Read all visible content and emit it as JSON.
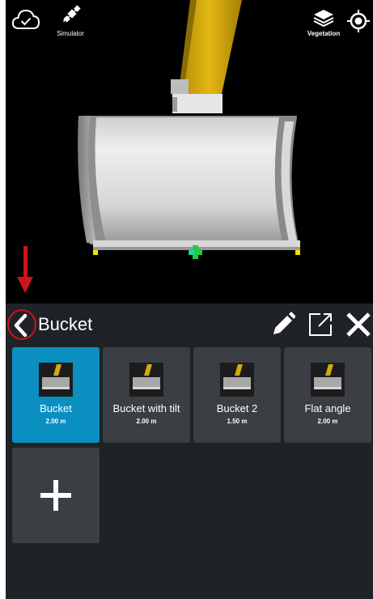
{
  "toolbar": {
    "simulator_label": "Simulator",
    "vegetation_label": "Vegetation"
  },
  "panel": {
    "title": "Bucket",
    "items": [
      {
        "name": "Bucket",
        "size": "2.00 m",
        "selected": true
      },
      {
        "name": "Bucket with tilt",
        "size": "2.00 m",
        "selected": false
      },
      {
        "name": "Bucket 2",
        "size": "1.50 m",
        "selected": false
      },
      {
        "name": "Flat angle",
        "size": "2.00 m",
        "selected": false
      }
    ]
  },
  "icons": {
    "cloud": "cloud-check-icon",
    "simulator": "satellite-icon",
    "vegetation": "layers-icon",
    "locate": "locate-icon",
    "back": "chevron-left-icon",
    "edit": "pencil-icon",
    "external": "open-external-icon",
    "close": "close-icon",
    "add": "plus-icon"
  },
  "colors": {
    "selected_card": "#0b8fc1",
    "card": "#3b3f43",
    "panel": "#1f2327",
    "annotation": "#d0131a",
    "boom": "#d4a90c"
  }
}
